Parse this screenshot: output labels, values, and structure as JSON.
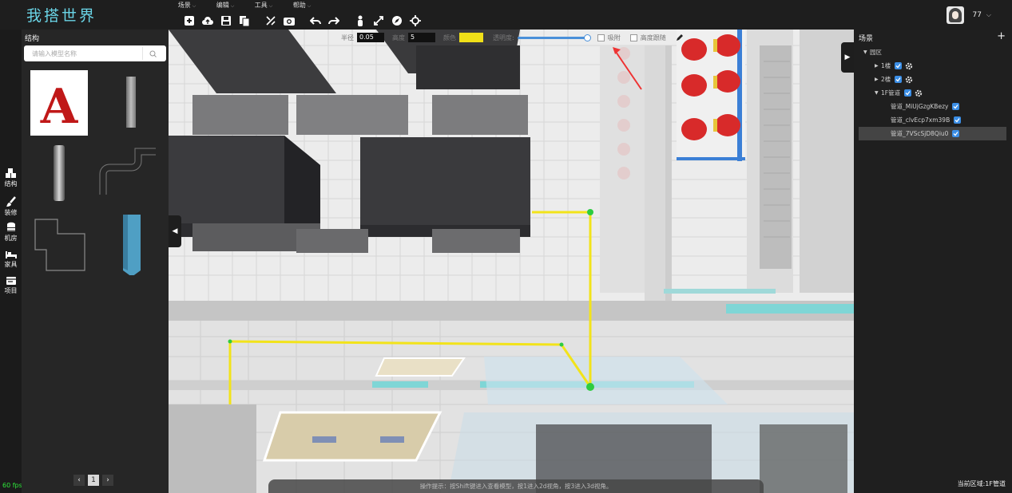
{
  "app": {
    "logo": "我搭世界"
  },
  "menu": [
    {
      "label": "场景"
    },
    {
      "label": "编辑"
    },
    {
      "label": "工具"
    },
    {
      "label": "帮助"
    }
  ],
  "toolbar_icons": [
    "add-icon",
    "cloud-upload-icon",
    "save-icon",
    "copy-icon",
    "measure-icon",
    "camera-icon",
    "undo-icon",
    "redo-icon",
    "person-icon",
    "expand-icon",
    "compass-icon",
    "crosshair-icon"
  ],
  "user": {
    "name": "77"
  },
  "rail": [
    {
      "label": "结构",
      "icon": "cubes-icon"
    },
    {
      "label": "装修",
      "icon": "brush-icon"
    },
    {
      "label": "机房",
      "icon": "database-icon"
    },
    {
      "label": "家具",
      "icon": "bed-icon"
    },
    {
      "label": "项目",
      "icon": "card-icon"
    }
  ],
  "fps": "60 fps",
  "structure": {
    "title": "结构",
    "search_placeholder": "请输入模型名称",
    "items": [
      "text-A-model",
      "column-model",
      "cylinder-model",
      "pipe-model",
      "floor-outline-model",
      "blue-panel-model"
    ],
    "pager": {
      "prev": "‹",
      "page": "1",
      "next": "›"
    }
  },
  "params": {
    "radius_label": "半径",
    "radius_value": "0.05",
    "height_label": "高度",
    "height_value": "5",
    "color_label": "颜色",
    "color_value": "#f0e018",
    "opacity_label": "透明度:",
    "opacity": 1.0,
    "snap_label": "吸附",
    "height_follow_label": "高度跟随"
  },
  "hint": "操作提示：按Shift键进入查看模型，按1进入2d视角，按3进入3d视角。",
  "scene": {
    "title": "场景",
    "add": "+",
    "root": "园区",
    "floors": [
      {
        "label": "1楼",
        "expanded": false
      },
      {
        "label": "2楼",
        "expanded": false
      },
      {
        "label": "1F管道",
        "expanded": true
      }
    ],
    "pipes": [
      {
        "label": "管道_MiUjGzgKBezy",
        "selected": false
      },
      {
        "label": "管道_clvEcp7xm39B",
        "selected": false
      },
      {
        "label": "管道_7VScSjD8Qiu0",
        "selected": true
      }
    ],
    "region": "当前区域:1F管道"
  }
}
